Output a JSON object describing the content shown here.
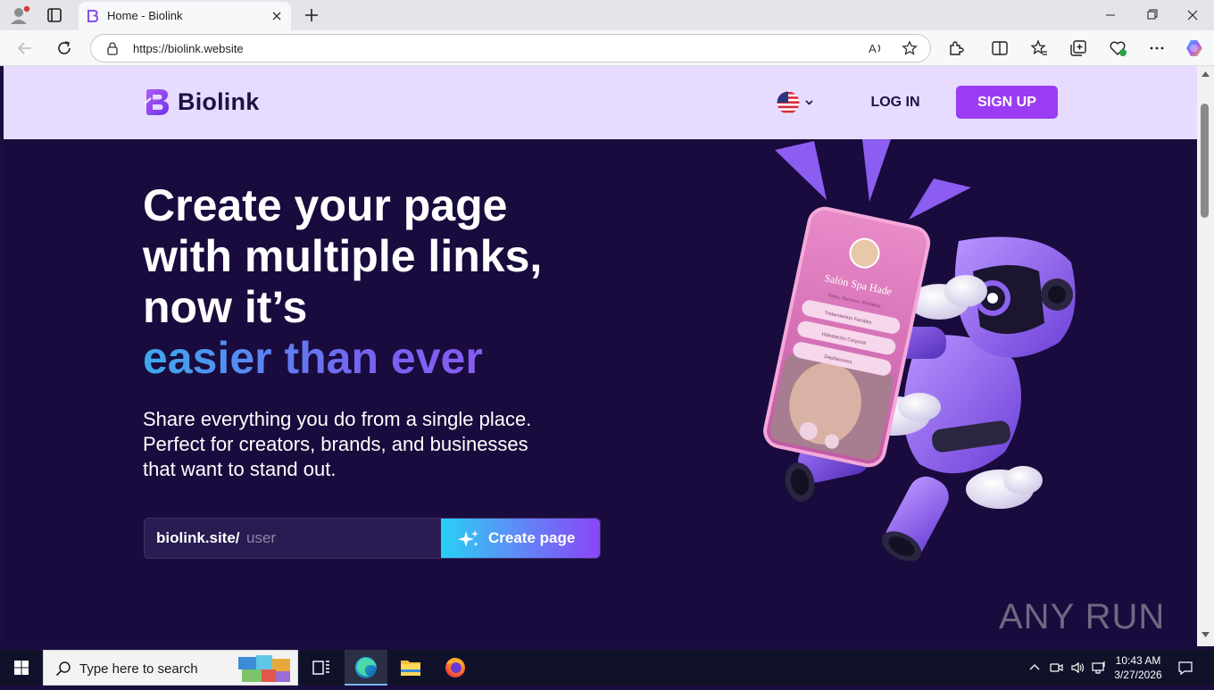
{
  "browser": {
    "tab_title": "Home - Biolink",
    "url": "https://biolink.website"
  },
  "site": {
    "logo_text": "Biolink",
    "login_label": "LOG IN",
    "signup_label": "SIGN UP",
    "language_flag": "us-flag-icon",
    "hero": {
      "line1": "Create your page",
      "line2": "with multiple links,",
      "line3": "now it’s",
      "highlight": "easier than ever",
      "sub1": "Share everything you do from a single place.",
      "sub2": "Perfect for creators, brands, and businesses",
      "sub3": "that want to stand out."
    },
    "form": {
      "prefix": "biolink.site/",
      "placeholder": "user",
      "button_label": "Create page"
    },
    "phone_card": {
      "name": "Salón Spa Hade",
      "tagline": "Relax, Renueva, Revitaliza",
      "links": [
        "Tratamientos Faciales",
        "Hidratación Corporal",
        "Depilaciones"
      ]
    },
    "colors": {
      "header_bg": "#e7dcff",
      "hero_bg": "#190b3d",
      "accent": "#9a3cf4"
    }
  },
  "taskbar": {
    "search_placeholder": "Type here to search",
    "time": "10:43 AM",
    "date": "3/27/2026"
  },
  "watermark": "ANY RUN"
}
